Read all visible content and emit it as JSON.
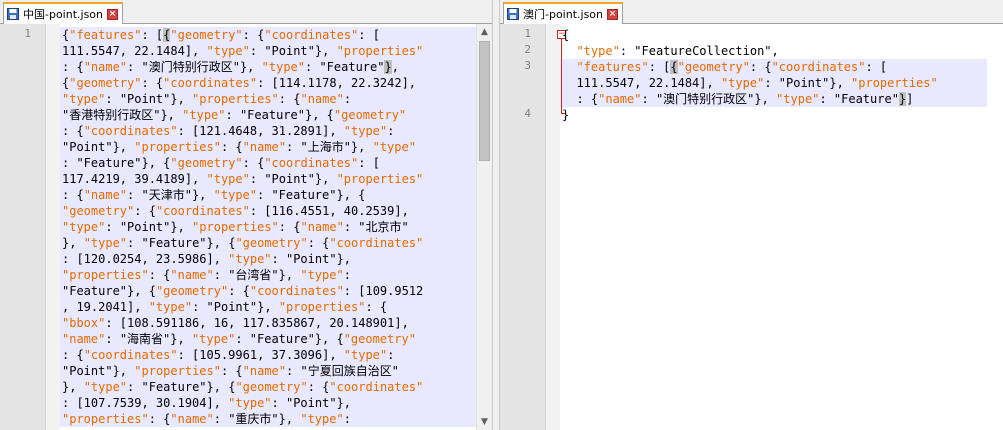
{
  "left": {
    "tab_label": "中国-point.json",
    "line_numbers": [
      "1"
    ],
    "lines": [
      [
        [
          "p",
          "{"
        ],
        [
          "k",
          "\"features\""
        ],
        [
          "p",
          ": ["
        ],
        [
          "sel",
          "{"
        ],
        [
          "k",
          "\"geometry\""
        ],
        [
          "p",
          ": {"
        ],
        [
          "k",
          "\"coordinates\""
        ],
        [
          "p",
          ": ["
        ]
      ],
      [
        [
          "t",
          "111.5547, 22.1484], "
        ],
        [
          "k",
          "\"type\""
        ],
        [
          "p",
          ": "
        ],
        [
          "t",
          "\"Point\""
        ],
        [
          "p",
          "}, "
        ],
        [
          "k",
          "\"properties\""
        ]
      ],
      [
        [
          "p",
          ": {"
        ],
        [
          "k",
          "\"name\""
        ],
        [
          "p",
          ": "
        ],
        [
          "t",
          "\"澳门特别行政区\""
        ],
        [
          "p",
          "}, "
        ],
        [
          "k",
          "\"type\""
        ],
        [
          "p",
          ": "
        ],
        [
          "t",
          "\"Feature\""
        ],
        [
          "sel",
          "}"
        ],
        [
          "p",
          ","
        ]
      ],
      [
        [
          "p",
          "{"
        ],
        [
          "k",
          "\"geometry\""
        ],
        [
          "p",
          ": {"
        ],
        [
          "k",
          "\"coordinates\""
        ],
        [
          "p",
          ": [114.1178, 22.3242],"
        ]
      ],
      [
        [
          "k",
          "\"type\""
        ],
        [
          "p",
          ": "
        ],
        [
          "t",
          "\"Point\""
        ],
        [
          "p",
          "}, "
        ],
        [
          "k",
          "\"properties\""
        ],
        [
          "p",
          ": {"
        ],
        [
          "k",
          "\"name\""
        ],
        [
          "p",
          ":"
        ]
      ],
      [
        [
          "t",
          "\"香港特别行政区\""
        ],
        [
          "p",
          "}, "
        ],
        [
          "k",
          "\"type\""
        ],
        [
          "p",
          ": "
        ],
        [
          "t",
          "\"Feature\""
        ],
        [
          "p",
          "}, {"
        ],
        [
          "k",
          "\"geometry\""
        ]
      ],
      [
        [
          "p",
          ": {"
        ],
        [
          "k",
          "\"coordinates\""
        ],
        [
          "p",
          ": [121.4648, 31.2891], "
        ],
        [
          "k",
          "\"type\""
        ],
        [
          "p",
          ":"
        ]
      ],
      [
        [
          "t",
          "\"Point\""
        ],
        [
          "p",
          "}, "
        ],
        [
          "k",
          "\"properties\""
        ],
        [
          "p",
          ": {"
        ],
        [
          "k",
          "\"name\""
        ],
        [
          "p",
          ": "
        ],
        [
          "t",
          "\"上海市\""
        ],
        [
          "p",
          "}, "
        ],
        [
          "k",
          "\"type\""
        ]
      ],
      [
        [
          "p",
          ": "
        ],
        [
          "t",
          "\"Feature\""
        ],
        [
          "p",
          "}, {"
        ],
        [
          "k",
          "\"geometry\""
        ],
        [
          "p",
          ": {"
        ],
        [
          "k",
          "\"coordinates\""
        ],
        [
          "p",
          ": ["
        ]
      ],
      [
        [
          "t",
          "117.4219, 39.4189], "
        ],
        [
          "k",
          "\"type\""
        ],
        [
          "p",
          ": "
        ],
        [
          "t",
          "\"Point\""
        ],
        [
          "p",
          "}, "
        ],
        [
          "k",
          "\"properties\""
        ]
      ],
      [
        [
          "p",
          ": {"
        ],
        [
          "k",
          "\"name\""
        ],
        [
          "p",
          ": "
        ],
        [
          "t",
          "\"天津市\""
        ],
        [
          "p",
          "}, "
        ],
        [
          "k",
          "\"type\""
        ],
        [
          "p",
          ": "
        ],
        [
          "t",
          "\"Feature\""
        ],
        [
          "p",
          "}, {"
        ]
      ],
      [
        [
          "k",
          "\"geometry\""
        ],
        [
          "p",
          ": {"
        ],
        [
          "k",
          "\"coordinates\""
        ],
        [
          "p",
          ": [116.4551, 40.2539],"
        ]
      ],
      [
        [
          "k",
          "\"type\""
        ],
        [
          "p",
          ": "
        ],
        [
          "t",
          "\"Point\""
        ],
        [
          "p",
          "}, "
        ],
        [
          "k",
          "\"properties\""
        ],
        [
          "p",
          ": {"
        ],
        [
          "k",
          "\"name\""
        ],
        [
          "p",
          ": "
        ],
        [
          "t",
          "\"北京市\""
        ]
      ],
      [
        [
          "p",
          "}, "
        ],
        [
          "k",
          "\"type\""
        ],
        [
          "p",
          ": "
        ],
        [
          "t",
          "\"Feature\""
        ],
        [
          "p",
          "}, {"
        ],
        [
          "k",
          "\"geometry\""
        ],
        [
          "p",
          ": {"
        ],
        [
          "k",
          "\"coordinates\""
        ]
      ],
      [
        [
          "p",
          ": [120.0254, 23.5986], "
        ],
        [
          "k",
          "\"type\""
        ],
        [
          "p",
          ": "
        ],
        [
          "t",
          "\"Point\""
        ],
        [
          "p",
          "},"
        ]
      ],
      [
        [
          "k",
          "\"properties\""
        ],
        [
          "p",
          ": {"
        ],
        [
          "k",
          "\"name\""
        ],
        [
          "p",
          ": "
        ],
        [
          "t",
          "\"台湾省\""
        ],
        [
          "p",
          "}, "
        ],
        [
          "k",
          "\"type\""
        ],
        [
          "p",
          ":"
        ]
      ],
      [
        [
          "t",
          "\"Feature\""
        ],
        [
          "p",
          "}, {"
        ],
        [
          "k",
          "\"geometry\""
        ],
        [
          "p",
          ": {"
        ],
        [
          "k",
          "\"coordinates\""
        ],
        [
          "p",
          ": [109.9512"
        ]
      ],
      [
        [
          "p",
          ", 19.2041], "
        ],
        [
          "k",
          "\"type\""
        ],
        [
          "p",
          ": "
        ],
        [
          "t",
          "\"Point\""
        ],
        [
          "p",
          "}, "
        ],
        [
          "k",
          "\"properties\""
        ],
        [
          "p",
          ": {"
        ]
      ],
      [
        [
          "k",
          "\"bbox\""
        ],
        [
          "p",
          ": [108.591186, 16, 117.835867, 20.148901],"
        ]
      ],
      [
        [
          "k",
          "\"name\""
        ],
        [
          "p",
          ": "
        ],
        [
          "t",
          "\"海南省\""
        ],
        [
          "p",
          "}, "
        ],
        [
          "k",
          "\"type\""
        ],
        [
          "p",
          ": "
        ],
        [
          "t",
          "\"Feature\""
        ],
        [
          "p",
          "}, {"
        ],
        [
          "k",
          "\"geometry\""
        ]
      ],
      [
        [
          "p",
          ": {"
        ],
        [
          "k",
          "\"coordinates\""
        ],
        [
          "p",
          ": [105.9961, 37.3096], "
        ],
        [
          "k",
          "\"type\""
        ],
        [
          "p",
          ":"
        ]
      ],
      [
        [
          "t",
          "\"Point\""
        ],
        [
          "p",
          "}, "
        ],
        [
          "k",
          "\"properties\""
        ],
        [
          "p",
          ": {"
        ],
        [
          "k",
          "\"name\""
        ],
        [
          "p",
          ": "
        ],
        [
          "t",
          "\"宁夏回族自治区\""
        ]
      ],
      [
        [
          "p",
          "}, "
        ],
        [
          "k",
          "\"type\""
        ],
        [
          "p",
          ": "
        ],
        [
          "t",
          "\"Feature\""
        ],
        [
          "p",
          "}, {"
        ],
        [
          "k",
          "\"geometry\""
        ],
        [
          "p",
          ": {"
        ],
        [
          "k",
          "\"coordinates\""
        ]
      ],
      [
        [
          "p",
          ": [107.7539, 30.1904], "
        ],
        [
          "k",
          "\"type\""
        ],
        [
          "p",
          ": "
        ],
        [
          "t",
          "\"Point\""
        ],
        [
          "p",
          "},"
        ]
      ],
      [
        [
          "k",
          "\"properties\""
        ],
        [
          "p",
          ": {"
        ],
        [
          "k",
          "\"name\""
        ],
        [
          "p",
          ": "
        ],
        [
          "t",
          "\"重庆市\""
        ],
        [
          "p",
          "}, "
        ],
        [
          "k",
          "\"type\""
        ],
        [
          "p",
          ":"
        ]
      ]
    ]
  },
  "right": {
    "tab_label": "澳门-point.json",
    "line_numbers": [
      "1",
      "2",
      "3",
      "4"
    ],
    "lines": [
      [
        [
          "p",
          "{"
        ]
      ],
      [
        [
          "p",
          "  "
        ],
        [
          "k",
          "\"type\""
        ],
        [
          "p",
          ": "
        ],
        [
          "t",
          "\"FeatureCollection\""
        ],
        [
          "p",
          ","
        ]
      ],
      [
        [
          "p",
          "  "
        ],
        [
          "k",
          "\"features\""
        ],
        [
          "p",
          ": ["
        ],
        [
          "sel",
          "{"
        ],
        [
          "k",
          "\"geometry\""
        ],
        [
          "p",
          ": {"
        ],
        [
          "k",
          "\"coordinates\""
        ],
        [
          "p",
          ": ["
        ]
      ],
      [
        [
          "t",
          "  111.5547, 22.1484], "
        ],
        [
          "k",
          "\"type\""
        ],
        [
          "p",
          ": "
        ],
        [
          "t",
          "\"Point\""
        ],
        [
          "p",
          "}, "
        ],
        [
          "k",
          "\"properties\""
        ]
      ],
      [
        [
          "p",
          "  : {"
        ],
        [
          "k",
          "\"name\""
        ],
        [
          "p",
          ": "
        ],
        [
          "t",
          "\"澳门特别行政区\""
        ],
        [
          "p",
          "}, "
        ],
        [
          "k",
          "\"type\""
        ],
        [
          "p",
          ": "
        ],
        [
          "t",
          "\"Feature\""
        ],
        [
          "sel",
          "}"
        ],
        [
          "p",
          "]"
        ]
      ],
      [
        [
          "p",
          "}"
        ]
      ]
    ]
  }
}
